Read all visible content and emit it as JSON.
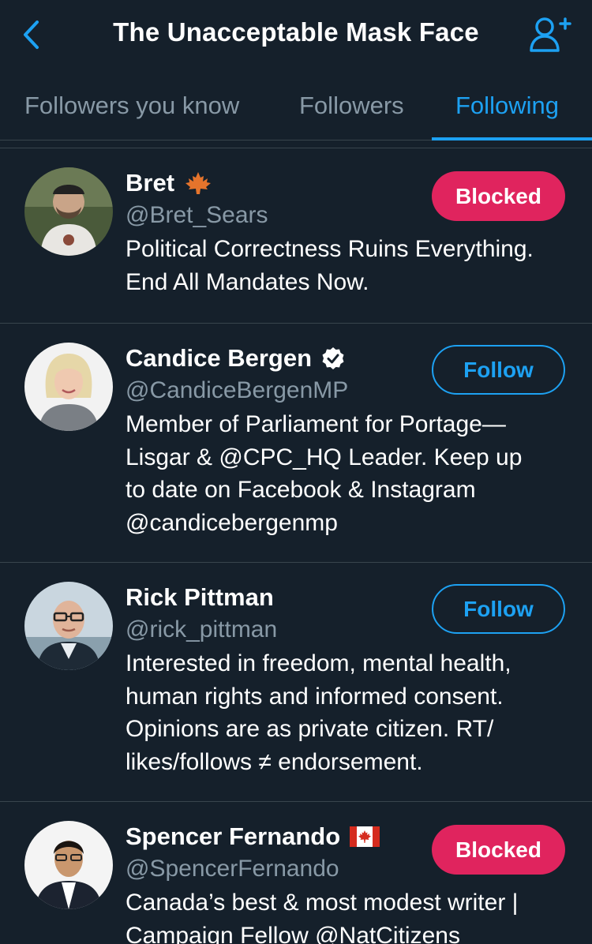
{
  "header": {
    "title": "The Unacceptable Mask Face"
  },
  "tabs": [
    {
      "label": "Followers you know",
      "active": false
    },
    {
      "label": "Followers",
      "active": false
    },
    {
      "label": "Following",
      "active": true
    }
  ],
  "colors": {
    "background": "#15202b",
    "accent": "#1da1f2",
    "blocked": "#e0245e",
    "secondary_text": "#8899a6",
    "divider": "#38444d"
  },
  "users": [
    {
      "name": "Bret",
      "name_badge": "maple-leaf-icon",
      "handle": "@Bret_Sears",
      "bio": [
        "Political Correctness Ruins Everything.",
        "End All Mandates Now."
      ],
      "button": "Blocked"
    },
    {
      "name": "Candice Bergen",
      "name_badge": "verified-badge-icon",
      "handle": "@CandiceBergenMP",
      "bio": [
        "Member of Parliament for Portage—",
        "Lisgar & @CPC_HQ Leader. Keep up",
        "to date on Facebook & Instagram",
        "@candicebergenmp"
      ],
      "button": "Follow"
    },
    {
      "name": "Rick Pittman",
      "name_badge": "",
      "handle": "@rick_pittman",
      "bio": [
        "Interested in freedom, mental health,",
        "human rights and informed consent.",
        "Opinions are as private citizen. RT/",
        "likes/follows ≠ endorsement."
      ],
      "button": "Follow"
    },
    {
      "name": "Spencer Fernando",
      "name_badge": "canada-flag-icon",
      "handle": "@SpencerFernando",
      "bio": [
        "Canada’s best & most modest writer |",
        "Campaign Fellow @NatCitizens"
      ],
      "button": "Blocked"
    }
  ]
}
